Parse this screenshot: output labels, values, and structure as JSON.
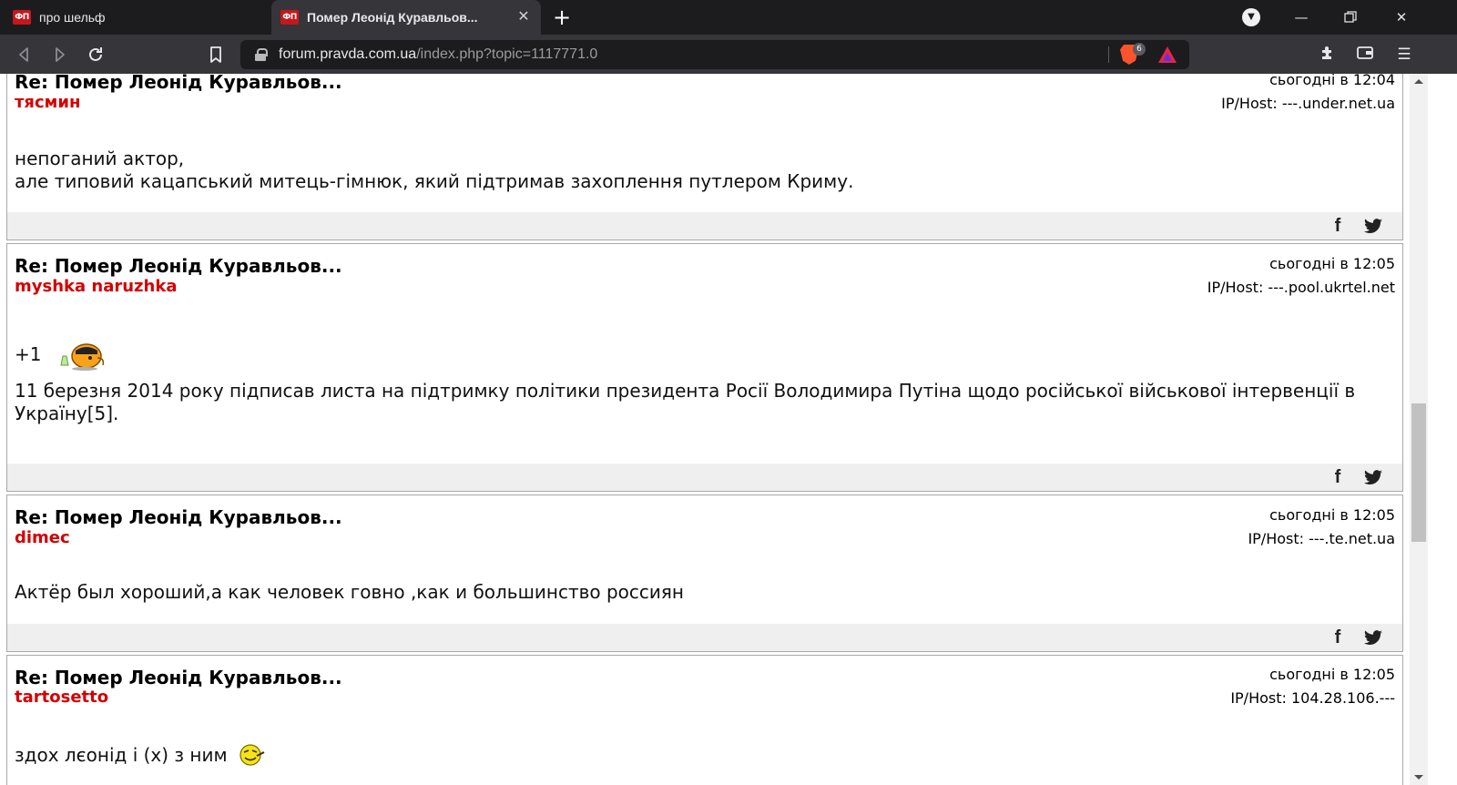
{
  "browser": {
    "tabs": [
      {
        "favicon_text": "ФП",
        "title": "про шельф"
      },
      {
        "favicon_text": "ФП",
        "title": "Помер Леонід Куравльов..."
      }
    ],
    "url_host": "forum.pravda.com.ua",
    "url_path": "/index.php?topic=1117771.0",
    "shields_count": "6"
  },
  "posts": [
    {
      "title": "Re: Помер Леонід Куравльов...",
      "author": "тясмин",
      "date": "сьогодні в 12:04",
      "ip": "IP/Host: ---.under.net.ua",
      "lines": [
        "непоганий актор,",
        "але типовий кацапський митець-гімнюк, який підтримав захоплення путлером Криму."
      ]
    },
    {
      "title": "Re: Помер Леонід Куравльов...",
      "author": "myshka naruzhka",
      "date": "сьогодні в 12:05",
      "ip": "IP/Host: ---.pool.ukrtel.net",
      "line1": "+1",
      "line2": "11 березня 2014 року підписав листа на підтримку політики президента Росії Володимира Путіна щодо російської військової інтервенції в Україну[5]."
    },
    {
      "title": "Re: Помер Леонід Куравльов...",
      "author": "dimec",
      "date": "сьогодні в 12:05",
      "ip": "IP/Host: ---.te.net.ua",
      "line1": "Актёр был хороший,а как человек говно ,как и большинство россиян"
    },
    {
      "title": "Re: Помер Леонід Куравльов...",
      "author": "tartosetto",
      "date": "сьогодні в 12:05",
      "ip": "IP/Host: 104.28.106.---",
      "line1": "здох лєонід і (х) з ним"
    }
  ]
}
